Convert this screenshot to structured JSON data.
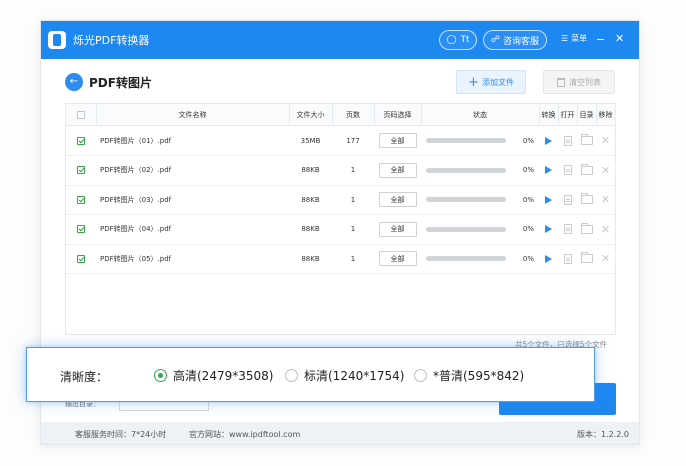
{
  "app": {
    "title": "烁光PDF转换器",
    "user_label": "Tt",
    "support_label": "咨询客服",
    "menu_label": "菜单"
  },
  "header": {
    "title": "PDF转图片",
    "add_file_label": "添加文件",
    "clear_list_label": "清空列表"
  },
  "table": {
    "columns": {
      "name": "文件名称",
      "size": "文件大小",
      "pages": "页数",
      "range": "页码选择",
      "status": "状态",
      "convert": "转换",
      "open": "打开",
      "folder": "目录",
      "remove": "移除"
    },
    "rows": [
      {
        "name": "PDF转图片（01）.pdf",
        "size": "35MB",
        "pages": "177",
        "range": "全部",
        "progress": "0%",
        "checked": true
      },
      {
        "name": "PDF转图片（02）.pdf",
        "size": "88KB",
        "pages": "1",
        "range": "全部",
        "progress": "0%",
        "checked": true
      },
      {
        "name": "PDF转图片（03）.pdf",
        "size": "88KB",
        "pages": "1",
        "range": "全部",
        "progress": "0%",
        "checked": true
      },
      {
        "name": "PDF转图片（04）.pdf",
        "size": "88KB",
        "pages": "1",
        "range": "全部",
        "progress": "0%",
        "checked": true
      },
      {
        "name": "PDF转图片（05）.pdf",
        "size": "88KB",
        "pages": "1",
        "range": "全部",
        "progress": "0%",
        "checked": true
      }
    ]
  },
  "summary": "共5个文件，已选择5个文件",
  "output": {
    "label": "输出目录："
  },
  "clarity": {
    "label": "清晰度：",
    "options": [
      {
        "label": "高清(2479*3508)",
        "selected": true
      },
      {
        "label": "标清(1240*1754)",
        "selected": false
      },
      {
        "label": "*普清(595*842)",
        "selected": false
      }
    ]
  },
  "status": {
    "service_hours": "客服服务时间：7*24小时",
    "website": "官方网站：www.ipdftool.com",
    "version": "版本：1.2.2.0"
  },
  "colors": {
    "brand": "#1d87f2",
    "selected_radio": "#34a853",
    "checkbox_check": "#2f9a3e"
  }
}
